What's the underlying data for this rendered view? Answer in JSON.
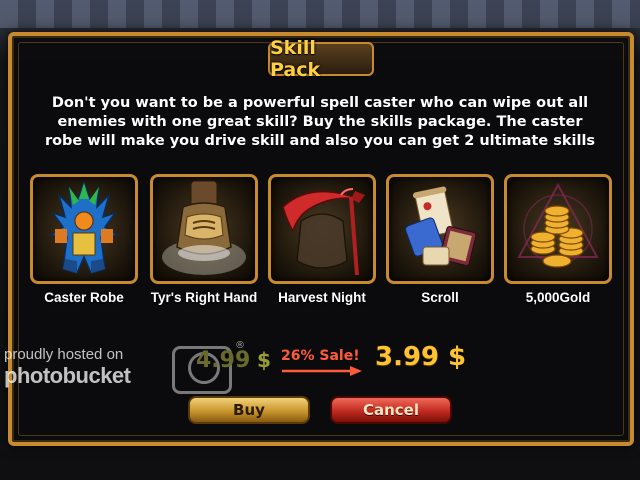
{
  "dialog": {
    "title": "Skill Pack",
    "description": "Don't you want to be a powerful spell caster who can wipe out all enemies with one great skill? Buy the skills package. The caster robe will make you drive skill and also you can get 2 ultimate skills"
  },
  "items": [
    {
      "label": "Caster Robe",
      "icon": "caster-robe-icon"
    },
    {
      "label": "Tyr's Right Hand",
      "icon": "gauntlet-icon"
    },
    {
      "label": "Harvest Night",
      "icon": "scythe-icon"
    },
    {
      "label": "Scroll",
      "icon": "scroll-icon"
    },
    {
      "label": "5,000Gold",
      "icon": "gold-coins-icon"
    }
  ],
  "pricing": {
    "old_price": "4.99",
    "currency": "$",
    "sale_label": "26% Sale!",
    "new_price": "3.99"
  },
  "buttons": {
    "buy": "Buy",
    "cancel": "Cancel"
  },
  "watermark": {
    "line1": "proudly hosted on",
    "line2": "photobucket",
    "reg": "®"
  },
  "colors": {
    "frame_gold": "#c88a2e",
    "title_yellow": "#ffd040",
    "sale_red": "#ff5a3a",
    "price_gold": "#ffc330",
    "buy_button": "#c8962c",
    "cancel_button": "#c02a20"
  }
}
